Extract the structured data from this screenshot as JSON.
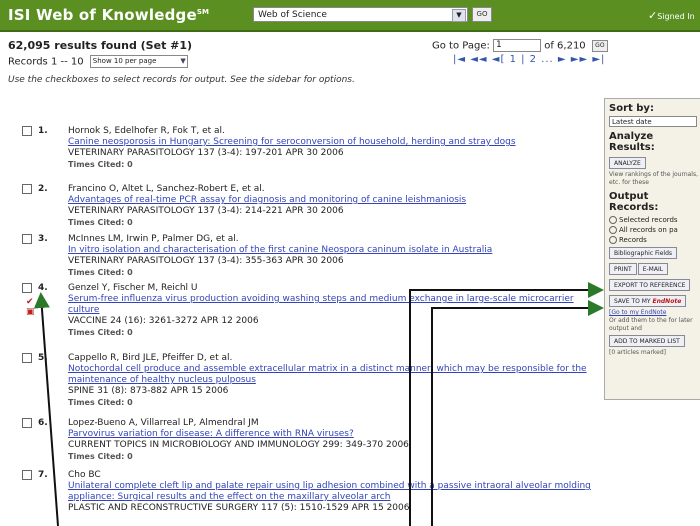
{
  "header": {
    "brand": "ISI Web of Knowledge",
    "brand_mark": "SM",
    "database": "Web of Science",
    "go_label": "GO",
    "signed_in": "Signed In"
  },
  "summary": {
    "results": "62,095 results found (Set #1)",
    "records_range": "Records 1 -- 10",
    "per_page": "Show 10 per page",
    "goto_label": "Go to Page:",
    "goto_value": "1",
    "page_count": "of 6,210",
    "go_small": "GO",
    "pager": "|◄ ◄◄ ◄[ 1 | 2 ... ► ►► ►|",
    "instructions": "Use the checkboxes to select records for output. See the sidebar for options."
  },
  "records": [
    {
      "num": "1.",
      "authors": "Hornok S, Edelhofer R, Fok T, et al.",
      "title": "Canine neosporosis in Hungary: Screening for seroconversion of household, herding and stray dogs",
      "source": "VETERINARY PARASITOLOGY 137 (3-4): 197-201 APR 30 2006",
      "cited": "Times Cited: 0"
    },
    {
      "num": "2.",
      "authors": "Francino O, Altet L, Sanchez-Robert E, et al.",
      "title": "Advantages of real-time PCR assay for diagnosis and monitoring of canine leishmaniosis",
      "source": "VETERINARY PARASITOLOGY 137 (3-4): 214-221 APR 30 2006",
      "cited": "Times Cited: 0"
    },
    {
      "num": "3.",
      "authors": "McInnes LM, Irwin P, Palmer DG, et al.",
      "title": "In vitro isolation and characterisation of the first canine Neospora caninum isolate in Australia",
      "source": "VETERINARY PARASITOLOGY 137 (3-4): 355-363 APR 30 2006",
      "cited": "Times Cited: 0"
    },
    {
      "num": "4.",
      "authors": "Genzel Y, Fischer M, Reichl U",
      "title": "Serum-free influenza virus production avoiding washing steps and medium exchange in large-scale microcarrier culture",
      "source": "VACCINE 24 (16): 3261-3272 APR 12 2006",
      "cited": "Times Cited: 0"
    },
    {
      "num": "5.",
      "authors": "Cappello R, Bird JLE, Pfeiffer D, et al.",
      "title": "Notochordal cell produce and assemble extracellular matrix in a distinct manner, which may be responsible for the maintenance of healthy nucleus pulposus",
      "source": "SPINE 31 (8): 873-882 APR 15 2006",
      "cited": "Times Cited: 0"
    },
    {
      "num": "6.",
      "authors": "Lopez-Bueno A, Villarreal LP, Almendral JM",
      "title": "Parvovirus variation for disease: A difference with RNA viruses?",
      "source": "CURRENT TOPICS IN MICROBIOLOGY AND IMMUNOLOGY 299: 349-370 2006",
      "cited": "Times Cited: 0"
    },
    {
      "num": "7.",
      "authors": "Cho BC",
      "title": "Unilateral complete cleft lip and palate repair using lip adhesion combined with a passive intraoral alveolar molding appliance: Surgical results and the effect on the maxillary alveolar arch",
      "source": "PLASTIC AND RECONSTRUCTIVE SURGERY 117 (5): 1510-1529 APR 15 2006",
      "cited": ""
    }
  ],
  "sidebar": {
    "sort_by": "Sort by:",
    "sort_value": "Latest date",
    "analyze_title": "Analyze Results:",
    "analyze_btn": "ANALYZE",
    "analyze_note": "View rankings of the journals, etc. for these",
    "output_title": "Output Records:",
    "opt_selected": "Selected records",
    "opt_all": "All records on pa",
    "opt_records": "Records",
    "fields": "Bibliographic Fields",
    "print": "PRINT",
    "email": "E-MAIL",
    "export": "EXPORT TO REFERENCE",
    "save_endnote": "SAVE TO MY",
    "endnote": "EndNote",
    "goto_endnote": "[Go to my EndNote",
    "add_note": "Or add them to the for later output and",
    "add_marked": "ADD TO MARKED LIST",
    "marked": "[0 articles marked]"
  }
}
